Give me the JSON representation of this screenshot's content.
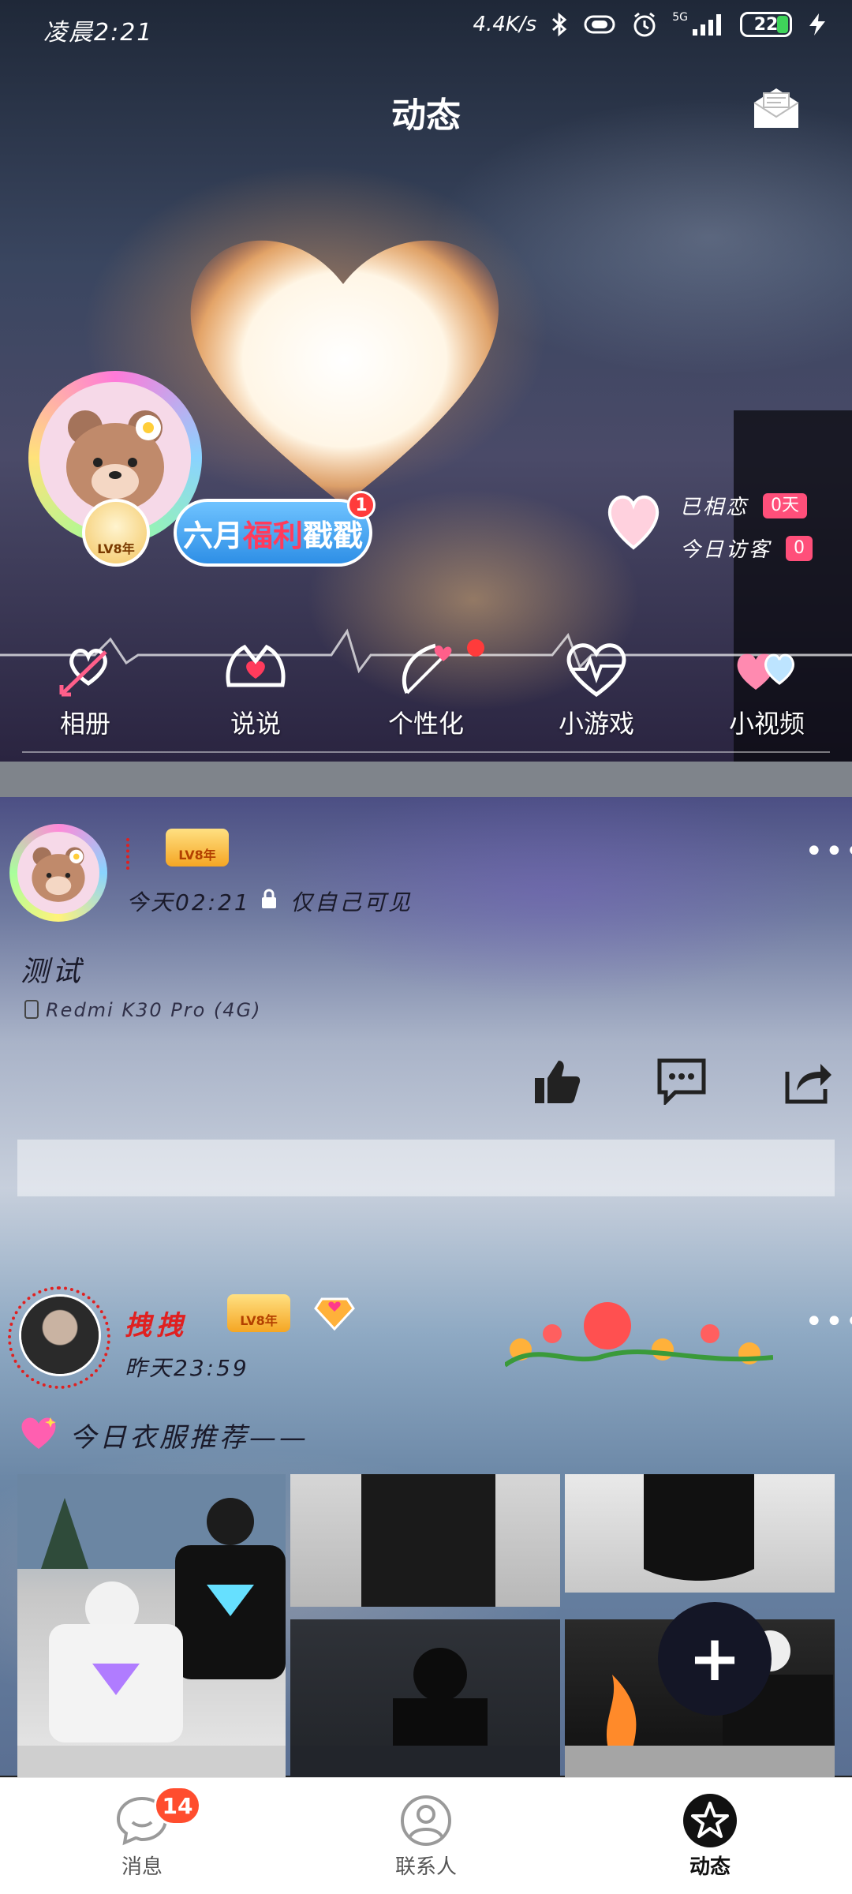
{
  "status_bar": {
    "time": "凌晨2:21",
    "net_speed": "4.4K/s",
    "network": "5G",
    "battery": "22"
  },
  "header": {
    "title": "动态"
  },
  "profile": {
    "level_badge": "LV8年",
    "promo": {
      "text_prefix": "六月",
      "text_highlight": "福利",
      "text_suffix": "戳戳",
      "badge_count": "1"
    },
    "stats": [
      {
        "label": "已相恋",
        "value": "0天"
      },
      {
        "label": "今日访客",
        "value": "0"
      }
    ]
  },
  "nav_items": [
    {
      "label": "相册",
      "icon": "arrow-heart-icon"
    },
    {
      "label": "说说",
      "icon": "hands-heart-icon"
    },
    {
      "label": "个性化",
      "icon": "bow-heart-icon"
    },
    {
      "label": "小游戏",
      "icon": "heartbeat-icon"
    },
    {
      "label": "小视频",
      "icon": "twin-hearts-icon"
    }
  ],
  "posts": [
    {
      "level": "LV8年",
      "time": "今天02:21",
      "privacy": "仅自己可见",
      "text": "测试",
      "device": "Redmi K30 Pro (4G)"
    },
    {
      "nickname": "拽拽",
      "level": "LV8年",
      "time": "昨天23:59",
      "text": "今日衣服推荐——"
    }
  ],
  "tabbar": {
    "items": [
      {
        "label": "消息",
        "badge": "14"
      },
      {
        "label": "联系人"
      },
      {
        "label": "动态"
      }
    ],
    "accent": "#ff4d2e"
  }
}
